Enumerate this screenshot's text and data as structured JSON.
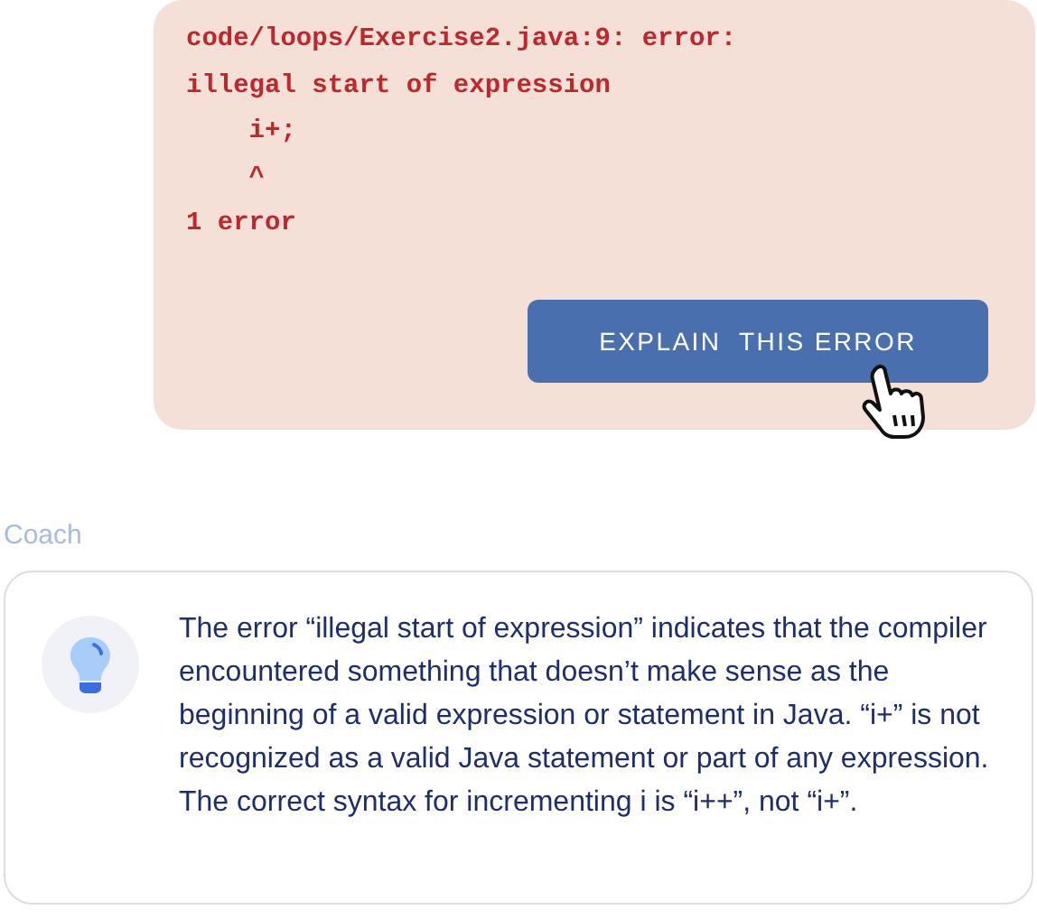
{
  "error_output": {
    "text": "code/loops/Exercise2.java:9: error:\nillegal start of expression\n    i+;\n    ^\n1 error"
  },
  "explain_button": {
    "label": "EXPLAIN  THIS ERROR"
  },
  "coach": {
    "label": "Coach",
    "paragraphs": [
      "The error “illegal start of expression” indicates that the compiler encountered something that doesn’t make sense as the beginning of a valid expression or statement in Java. “i+” is not recognized as a valid Java statement or part of any expression.",
      "The correct syntax for incrementing i is “i++”, not “i+”."
    ]
  }
}
